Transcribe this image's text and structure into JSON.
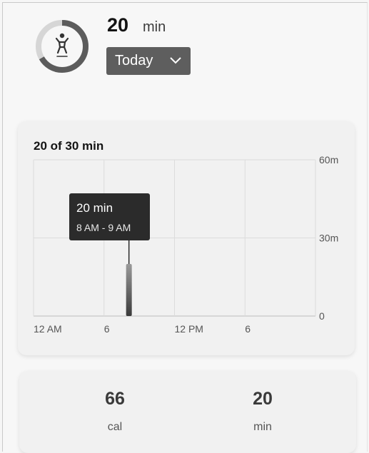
{
  "summary": {
    "value": "20",
    "unit": "min",
    "progress_fraction": 0.6667,
    "icon": "person-standing-icon"
  },
  "period_selector": {
    "label": "Today",
    "icon": "chevron-down-icon"
  },
  "chart_card": {
    "title": "20 of 30 min",
    "tooltip": {
      "value": "20 min",
      "range": "8 AM - 9 AM"
    }
  },
  "chart_data": {
    "type": "bar",
    "title": "20 of 30 min",
    "x_tick_labels": [
      "12 AM",
      "6",
      "12 PM",
      "6"
    ],
    "y_tick_labels": [
      "60m",
      "30m",
      "0"
    ],
    "ylim": [
      0,
      60
    ],
    "grid": true,
    "x": [
      "8 AM - 9 AM"
    ],
    "values": [
      20
    ],
    "unit": "min"
  },
  "stats": [
    {
      "value": "66",
      "unit": "cal"
    },
    {
      "value": "20",
      "unit": "min"
    }
  ],
  "colors": {
    "ring_track": "#d6d6d6",
    "ring_progress": "#5c5c5c",
    "button_bg": "#5e5e5e",
    "tooltip_bg": "#2b2b2b",
    "grid": "#dcdcdc"
  }
}
